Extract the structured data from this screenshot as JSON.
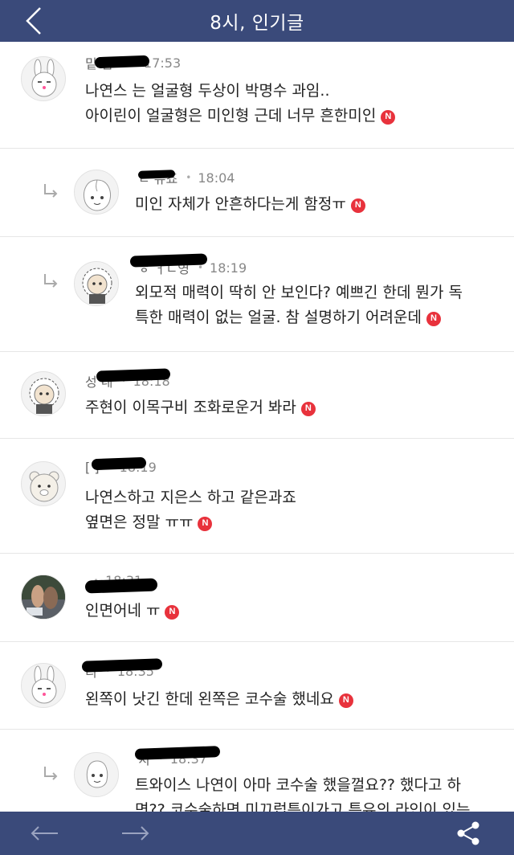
{
  "header": {
    "title": "8시, 인기글"
  },
  "comments": [
    {
      "author": "밑        님~",
      "time": "17:53",
      "lines": [
        "나연스 는 얼굴형 두상이 박명수 과임..",
        "아이린이 얼굴형은 미인형 근데 너무 흔한미인"
      ],
      "badge": "N",
      "avatar": "rabbit"
    },
    {
      "author": "ㄴ     쥬죠",
      "time": "18:04",
      "lines": [
        "미인 자체가 안흔하다는게 함정ㅠ"
      ],
      "badge": "N",
      "avatar": "peach"
    },
    {
      "author": "   ㅎ     ㅓㄴ영",
      "time": "18:19",
      "lines": [
        "외모적 매력이 딱히 안 보인다? 예쁘긴 한데 뭔가 독",
        "특한 매력이 없는 얼굴. 참 설명하기 어려운데"
      ],
      "badge": "N",
      "avatar": "frodo"
    },
    {
      "author": "성        네",
      "time": "18:18",
      "lines": [
        "주현이 이목구비 조화로운거 봐라"
      ],
      "badge": "N",
      "avatar": "frodo"
    },
    {
      "author": "[      ]",
      "time": "18:19",
      "lines": [
        "나연스하고 지은스 하고 같은과죠",
        "옆면은 정말 ㅠㅠ"
      ],
      "badge": "N",
      "avatar": "ryan"
    },
    {
      "author": "       ",
      "time": "18:31",
      "lines": [
        "인면어네 ㅠ"
      ],
      "badge": "N",
      "avatar": "photo"
    },
    {
      "author": "        리",
      "time": "18:35",
      "lines": [
        "왼쪽이 낫긴 한데 왼쪽은 코수술 했네요"
      ],
      "badge": "N",
      "avatar": "rabbit"
    },
    {
      "author": "        치",
      "time": "18:37",
      "lines": [
        "트와이스 나연이 아마 코수술 했을껄요?? 했다고 하",
        "면?? 코수술하면 미끄럽틍이가고 특유의 라인이 있는"
      ],
      "badge": "",
      "avatar": "muzi"
    }
  ],
  "icons": {
    "back": "chevron-left-icon",
    "reply": "reply-arrow-icon",
    "prev": "arrow-left-icon",
    "next": "arrow-right-icon",
    "share": "share-icon"
  },
  "colors": {
    "bar": "#3a4a7a",
    "badge": "#e8323c"
  }
}
